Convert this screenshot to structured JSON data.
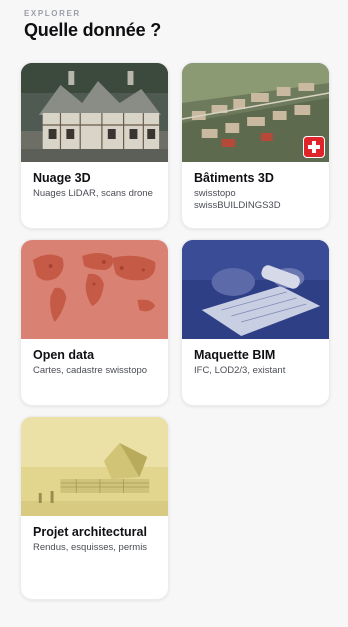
{
  "header": {
    "eyebrow": "EXPLORER",
    "title": "Quelle donnée ?"
  },
  "cards": [
    {
      "title": "Nuage 3D",
      "subtitle": "Nuages LiDAR, scans drone",
      "image": "point-cloud-building-photo"
    },
    {
      "title": "Bâtiments 3D",
      "subtitle": "swisstopo swissBUILDINGS3D",
      "image": "3d-city-model-photo",
      "badge": "swiss-flag-icon"
    },
    {
      "title": "Open data",
      "subtitle": "Cartes, cadastre swisstopo",
      "image": "world-map-photo"
    },
    {
      "title": "Maquette BIM",
      "subtitle": "IFC, LOD2/3, existant",
      "image": "architect-drawing-photo"
    },
    {
      "title": "Projet architectural",
      "subtitle": "Rendus, esquisses, permis",
      "image": "architectural-render-photo"
    }
  ],
  "colors": {
    "swiss_red": "#e0242b",
    "text_primary": "#101014",
    "text_secondary": "#4a4d55",
    "eyebrow": "#9a9ea6"
  }
}
